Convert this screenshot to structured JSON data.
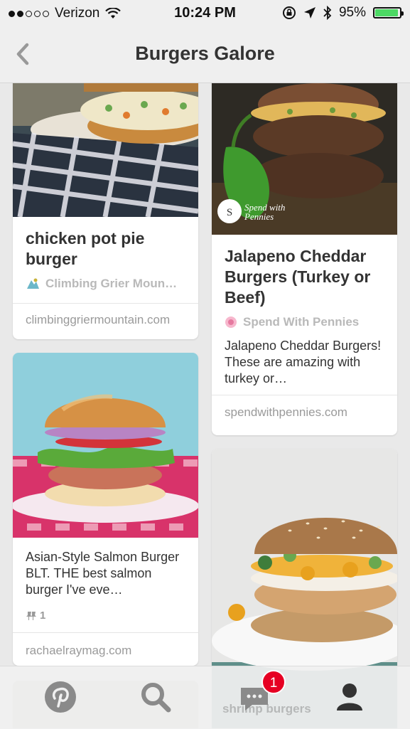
{
  "status_bar": {
    "carrier": "Verizon",
    "time": "10:24 PM",
    "battery_percent": "95%",
    "battery_level": 0.95,
    "battery_color": "#4cd964"
  },
  "nav": {
    "title": "Burgers Galore",
    "back_icon": "chevron-left-icon"
  },
  "feed": {
    "pins": [
      {
        "title": "chicken pot pie burger",
        "pinner": "Climbing Grier Moun…",
        "domain": "climbinggriermountain.com"
      },
      {
        "title": "Jalapeno Cheddar Burgers (Turkey or Beef)",
        "pinner": "Spend With Pennies",
        "description": "Jalapeno Cheddar Burgers! These are amazing with turkey or…",
        "domain": "spendwithpennies.com",
        "image_watermark": "Spend with Pennies"
      },
      {
        "description": "Asian-Style Salmon Burger BLT. THE best salmon burger I've eve…",
        "repin_count": "1",
        "domain": "rachaelraymag.com"
      },
      {
        "peek_text": "shrimp burgers"
      }
    ]
  },
  "tabbar": {
    "tabs": [
      "pinterest-home-icon",
      "search-icon",
      "messages-icon",
      "profile-icon"
    ],
    "notification_count": "1",
    "accent_color": "#e60023"
  }
}
